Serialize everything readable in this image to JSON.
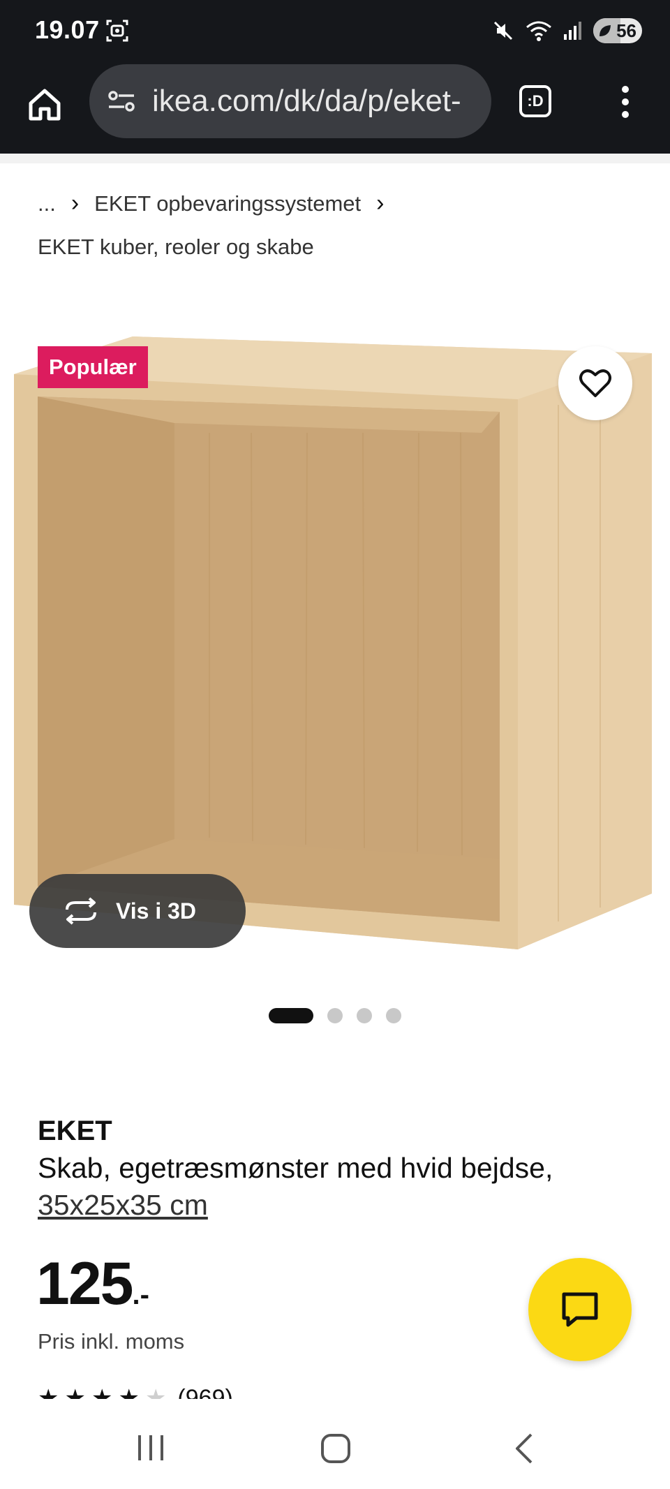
{
  "status_bar": {
    "time": "19.07",
    "battery": "56",
    "battery_level": 0.56
  },
  "browser": {
    "url": "ikea.com/dk/da/p/eket-",
    "tabs_label": ":D"
  },
  "breadcrumb": {
    "ellipsis": "...",
    "items": [
      "EKET opbevaringssystemet",
      "EKET kuber, reoler og skabe"
    ]
  },
  "product": {
    "badge": "Populær",
    "view_3d_label": "Vis i 3D",
    "carousel": {
      "count": 4,
      "active": 0
    },
    "name": "EKET",
    "description": "Skab, egetræsmønster med hvid bejdse,",
    "size": "35x25x35 cm",
    "price": "125",
    "price_suffix": ".-",
    "price_note": "Pris inkl. moms",
    "rating": {
      "stars": 4,
      "max": 5,
      "count": "(969)"
    }
  },
  "colors": {
    "status_bg": "#15171b",
    "badge": "#dc1c5e",
    "chat": "#fbd914",
    "wood": "#d9b98c"
  },
  "icons": {
    "home": "home-icon",
    "tune": "tune-icon",
    "menu": "more-vert-icon",
    "favorite": "heart-icon",
    "rotate": "rotate-3d-icon",
    "chat": "chat-icon"
  }
}
